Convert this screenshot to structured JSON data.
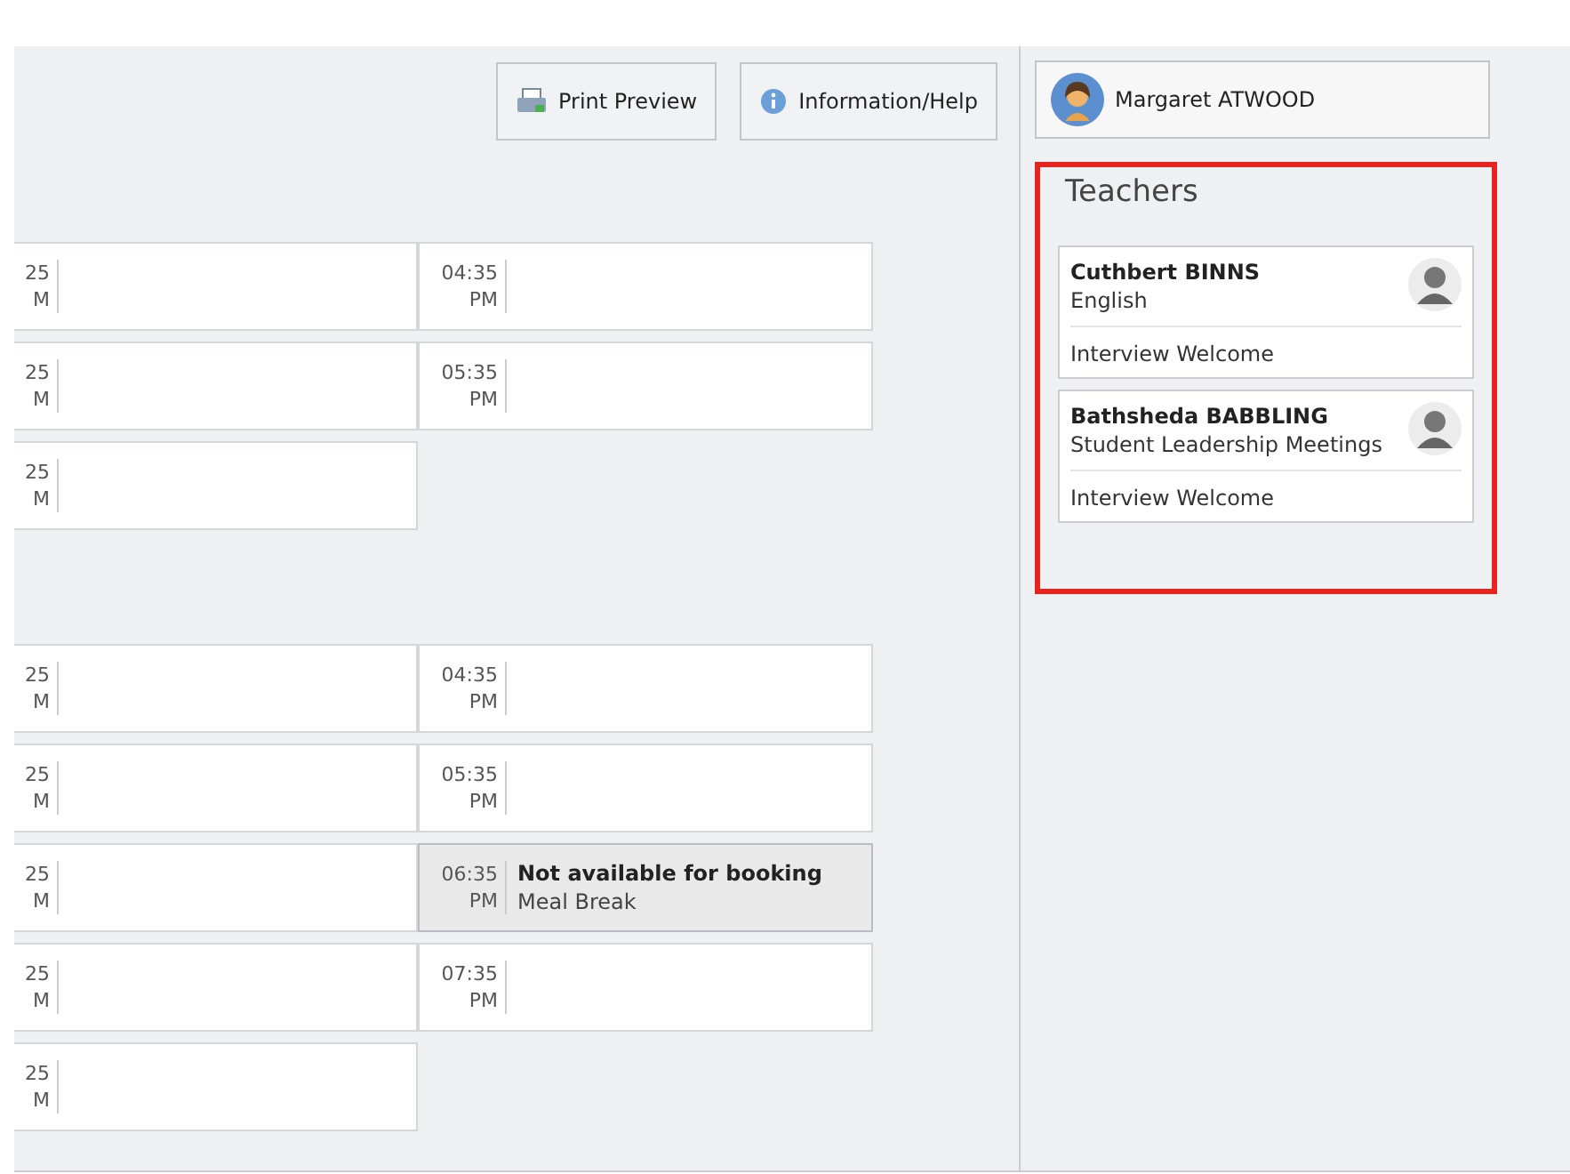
{
  "toolbar": {
    "buttons": [
      {
        "kind": "print",
        "label": "Print Preview"
      },
      {
        "kind": "info",
        "label": "Information/Help"
      }
    ]
  },
  "user": {
    "name": "Margaret ATWOOD"
  },
  "sessions": [
    {
      "rows": [
        {
          "left": {
            "time": "25",
            "period": "M"
          },
          "right": {
            "kind": "open",
            "time": "04:35",
            "period": "PM"
          }
        },
        {
          "left": {
            "time": "25",
            "period": "M"
          },
          "right": {
            "kind": "open",
            "time": "05:35",
            "period": "PM"
          }
        },
        {
          "left": {
            "time": "25",
            "period": "M"
          }
        }
      ]
    },
    {
      "rows": [
        {
          "left": {
            "time": "25",
            "period": "M"
          },
          "right": {
            "kind": "open",
            "time": "04:35",
            "period": "PM"
          }
        },
        {
          "left": {
            "time": "25",
            "period": "M"
          },
          "right": {
            "kind": "open",
            "time": "05:35",
            "period": "PM"
          }
        },
        {
          "left": {
            "time": "25",
            "period": "M"
          },
          "right": {
            "kind": "unavailable",
            "time": "06:35",
            "period": "PM",
            "title": "Not available for booking",
            "note": "Meal Break"
          }
        },
        {
          "left": {
            "time": "25",
            "period": "M"
          },
          "right": {
            "kind": "open",
            "time": "07:35",
            "period": "PM"
          }
        },
        {
          "left": {
            "time": "25",
            "period": "M"
          }
        }
      ]
    }
  ],
  "teachers": {
    "title": "Teachers",
    "items": [
      {
        "name": "Cuthbert BINNS",
        "subject": "English",
        "status": "Interview Welcome"
      },
      {
        "name": "Bathsheda BABBLING",
        "subject": "Student Leadership Meetings",
        "status": "Interview Welcome"
      }
    ]
  }
}
